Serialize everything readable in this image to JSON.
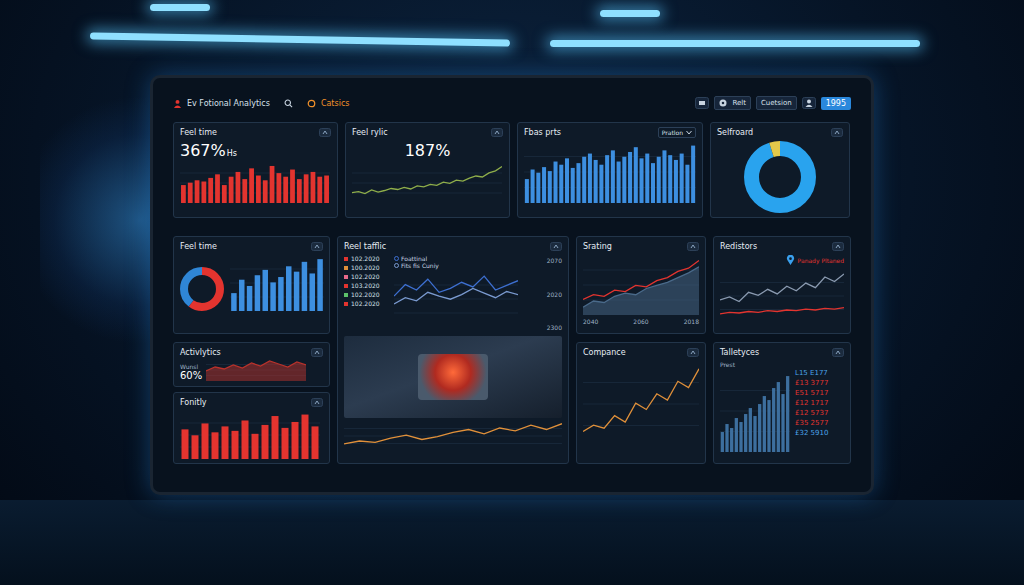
{
  "header": {
    "title": "Ev Fotional Analytics",
    "tab": "Catsics",
    "buttons": [
      {
        "label": "Relt"
      },
      {
        "label": "Cuetsion"
      }
    ],
    "year": "1995"
  },
  "feel_time": {
    "title": "Feel time",
    "value": "367%",
    "unit": "Hs",
    "series": [
      {
        "values": [
          30,
          34,
          38,
          36,
          42,
          48,
          30,
          44,
          52,
          40,
          58,
          46,
          38,
          62,
          50,
          44,
          56,
          40,
          48,
          52,
          44,
          46
        ],
        "color": "#e3342f"
      }
    ]
  },
  "feel_rylic": {
    "title": "Feel rylic",
    "value": "187%",
    "series": [
      {
        "values": [
          20,
          22,
          18,
          25,
          21,
          24,
          28,
          26,
          30,
          27,
          33,
          31,
          36,
          34,
          40,
          38,
          44,
          42,
          48,
          52,
          50,
          58,
          62,
          70
        ],
        "color": "#8fae4a",
        "kind": "line"
      }
    ]
  },
  "fbas_prts": {
    "title": "Fbas prts",
    "dropdown": "Pratlon",
    "series": [
      {
        "values": [
          30,
          42,
          38,
          45,
          40,
          52,
          48,
          56,
          44,
          50,
          58,
          62,
          54,
          48,
          60,
          66,
          52,
          58,
          64,
          70,
          56,
          62,
          50,
          58,
          66,
          60,
          54,
          62,
          48,
          72
        ],
        "color": "#3d8fe0"
      }
    ]
  },
  "selfroard": {
    "title": "Selfroard",
    "donut": [
      {
        "value": 95,
        "color": "#29a3ee"
      },
      {
        "value": 5,
        "color": "#e3c94a"
      }
    ]
  },
  "feel_time_2": {
    "title": "Feel time",
    "donut": [
      {
        "value": 60,
        "color": "#e3342f"
      },
      {
        "value": 40,
        "color": "#2f86d6"
      }
    ],
    "series": [
      {
        "values": [
          20,
          35,
          28,
          40,
          46,
          32,
          38,
          50,
          44,
          55,
          42,
          58
        ],
        "color": "#3d8fe0"
      }
    ]
  },
  "reel_tafflic": {
    "title": "Reel tafflic",
    "legend": [
      {
        "label": "102.2020",
        "color": "#e3342f"
      },
      {
        "label": "100.2020",
        "color": "#e0903a"
      },
      {
        "label": "102.2020",
        "color": "#e86a8a"
      },
      {
        "label": "103.2020",
        "color": "#e3342f"
      },
      {
        "label": "102.2020",
        "color": "#5cc26a"
      },
      {
        "label": "102.2020",
        "color": "#e3342f"
      }
    ],
    "series_labels": [
      "Foattinal",
      "Fits fis Cuniy"
    ],
    "ticks": [
      "2070",
      "2020",
      "2300"
    ],
    "series": [
      {
        "values": [
          40,
          55,
          48,
          62,
          45,
          50,
          58,
          52,
          66,
          48,
          54,
          60
        ],
        "color": "#3d6fd0",
        "kind": "line"
      },
      {
        "values": [
          30,
          38,
          34,
          45,
          40,
          36,
          42,
          50,
          44,
          38,
          46,
          42
        ],
        "color": "#7a9ad0",
        "kind": "line"
      }
    ],
    "lower_series": [
      {
        "values": [
          10,
          14,
          12,
          18,
          22,
          16,
          20,
          26,
          30,
          24,
          32,
          28,
          36,
          30,
          38
        ],
        "color": "#e0903a",
        "kind": "line"
      }
    ]
  },
  "srating": {
    "title": "Srating",
    "ticks": [
      "2040",
      "2060",
      "2018"
    ],
    "series": [
      {
        "values": [
          10,
          18,
          16,
          24,
          28,
          26,
          34,
          38,
          42,
          48,
          54,
          62
        ],
        "color": "#4a6a8a",
        "kind": "area"
      },
      {
        "values": [
          20,
          26,
          24,
          32,
          30,
          38,
          36,
          44,
          48,
          56,
          60,
          70
        ],
        "color": "#e3342f",
        "kind": "line"
      }
    ]
  },
  "redistors": {
    "title": "Redistors",
    "note": "Panady Pltaned",
    "series": [
      {
        "values": [
          30,
          34,
          28,
          40,
          36,
          44,
          38,
          48,
          42,
          52,
          46,
          60,
          54,
          64
        ],
        "color": "#8a9ab0",
        "kind": "line"
      },
      {
        "values": [
          12,
          14,
          13,
          15,
          14,
          16,
          15,
          17,
          16,
          18,
          17,
          19,
          18,
          20
        ],
        "color": "#e3342f",
        "kind": "line"
      }
    ]
  },
  "activlytics": {
    "title": "Activlytics",
    "label": "Wunsl",
    "value": "60%",
    "series": [
      {
        "values": [
          20,
          28,
          24,
          32,
          26,
          36,
          30,
          40,
          34,
          28,
          38,
          32
        ],
        "color": "#b8322b",
        "kind": "area"
      }
    ]
  },
  "fonitly": {
    "title": "Fonitly",
    "series": [
      {
        "values": [
          40,
          32,
          48,
          36,
          44,
          38,
          52,
          34,
          46,
          58,
          42,
          50,
          60,
          44
        ],
        "color": "#e3342f"
      }
    ]
  },
  "compance": {
    "title": "Compance",
    "series": [
      {
        "values": [
          10,
          14,
          12,
          20,
          16,
          28,
          24,
          34,
          30,
          42,
          38,
          50
        ],
        "color": "#e0903a",
        "kind": "line"
      }
    ]
  },
  "talletyces": {
    "title": "Talletyces",
    "label": "Prest",
    "series": [
      {
        "values": [
          20,
          28,
          24,
          34,
          30,
          38,
          44,
          36,
          48,
          56,
          52,
          64,
          70,
          58,
          76
        ],
        "color": "#3d6f9e"
      }
    ],
    "rows": [
      {
        "text": "L15 E177",
        "color": "#4aa3e8"
      },
      {
        "text": "£13 3777",
        "color": "#e3342f"
      },
      {
        "text": "E51 5717",
        "color": "#e3342f"
      },
      {
        "text": "£12 1717",
        "color": "#e3342f"
      },
      {
        "text": "£12 5737",
        "color": "#e3342f"
      },
      {
        "text": "£35 2577",
        "color": "#e3342f"
      },
      {
        "text": "£32 5910",
        "color": "#4aa3e8"
      }
    ]
  }
}
